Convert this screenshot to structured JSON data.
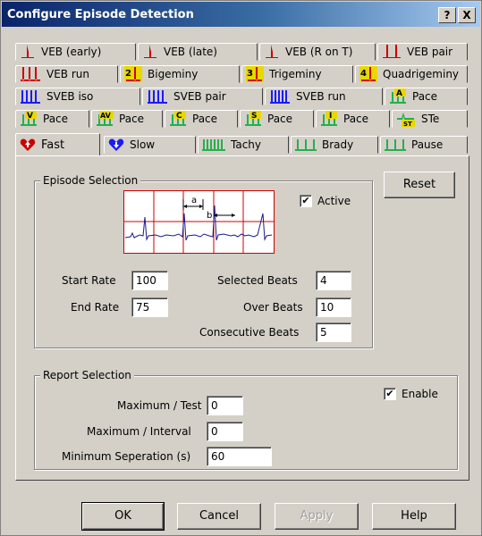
{
  "window": {
    "title": "Configure Episode Detection",
    "help_label": "?",
    "close_label": "X"
  },
  "tabs": {
    "row1": [
      {
        "label": "VEB (early)",
        "icon": "veb-early-icon"
      },
      {
        "label": "VEB (late)",
        "icon": "veb-late-icon"
      },
      {
        "label": "VEB (R on T)",
        "icon": "veb-r-on-t-icon"
      },
      {
        "label": "VEB pair",
        "icon": "veb-pair-icon"
      }
    ],
    "row2": [
      {
        "label": "VEB run",
        "icon": "veb-run-icon"
      },
      {
        "label": "Bigeminy",
        "icon": "bigeminy-icon",
        "badge": "2"
      },
      {
        "label": "Trigeminy",
        "icon": "trigeminy-icon",
        "badge": "3"
      },
      {
        "label": "Quadrigeminy",
        "icon": "quadrigeminy-icon",
        "badge": "4"
      }
    ],
    "row3": [
      {
        "label": "SVEB iso",
        "icon": "sveb-iso-icon"
      },
      {
        "label": "SVEB pair",
        "icon": "sveb-pair-icon"
      },
      {
        "label": "SVEB run",
        "icon": "sveb-run-icon"
      },
      {
        "label": "Pace",
        "icon": "pace-a-icon",
        "badge": "A"
      }
    ],
    "row4": [
      {
        "label": "Pace",
        "icon": "pace-v-icon",
        "badge": "V"
      },
      {
        "label": "Pace",
        "icon": "pace-av-icon",
        "badge": "AV"
      },
      {
        "label": "Pace",
        "icon": "pace-c-icon",
        "badge": "C"
      },
      {
        "label": "Pace",
        "icon": "pace-s-icon",
        "badge": "S"
      },
      {
        "label": "Pace",
        "icon": "pace-i-icon",
        "badge": "I"
      },
      {
        "label": "STe",
        "icon": "st-elevation-icon",
        "badge": "ST"
      }
    ],
    "row5": [
      {
        "label": "Fast",
        "icon": "heart-up-icon"
      },
      {
        "label": "Slow",
        "icon": "heart-down-icon"
      },
      {
        "label": "Tachy",
        "icon": "tachy-icon"
      },
      {
        "label": "Brady",
        "icon": "brady-icon"
      },
      {
        "label": "Pause",
        "icon": "pause-icon"
      }
    ]
  },
  "episode": {
    "legend": "Episode Selection",
    "diagram_a": "a",
    "diagram_b": "b",
    "active_label": "Active",
    "active_checked": true,
    "check_mark": "✔",
    "start_rate_label": "Start Rate",
    "start_rate_value": "100",
    "end_rate_label": "End Rate",
    "end_rate_value": "75",
    "selected_beats_label": "Selected Beats",
    "selected_beats_value": "4",
    "over_beats_label": "Over Beats",
    "over_beats_value": "10",
    "consecutive_beats_label": "Consecutive Beats",
    "consecutive_beats_value": "5"
  },
  "reset_label": "Reset",
  "report": {
    "legend": "Report Selection",
    "max_test_label": "Maximum / Test",
    "max_test_value": "0",
    "max_interval_label": "Maximum / Interval",
    "max_interval_value": "0",
    "min_sep_label": "Minimum Seperation (s)",
    "min_sep_value": "60",
    "enable_label": "Enable",
    "enable_checked": true
  },
  "buttons": {
    "ok": "OK",
    "cancel": "Cancel",
    "apply": "Apply",
    "help": "Help"
  },
  "colors": {
    "title_start": "#0a246a",
    "red": "#cc0000",
    "blue": "#1a1aff",
    "green": "#22b14c",
    "yellow": "#e8d800"
  }
}
